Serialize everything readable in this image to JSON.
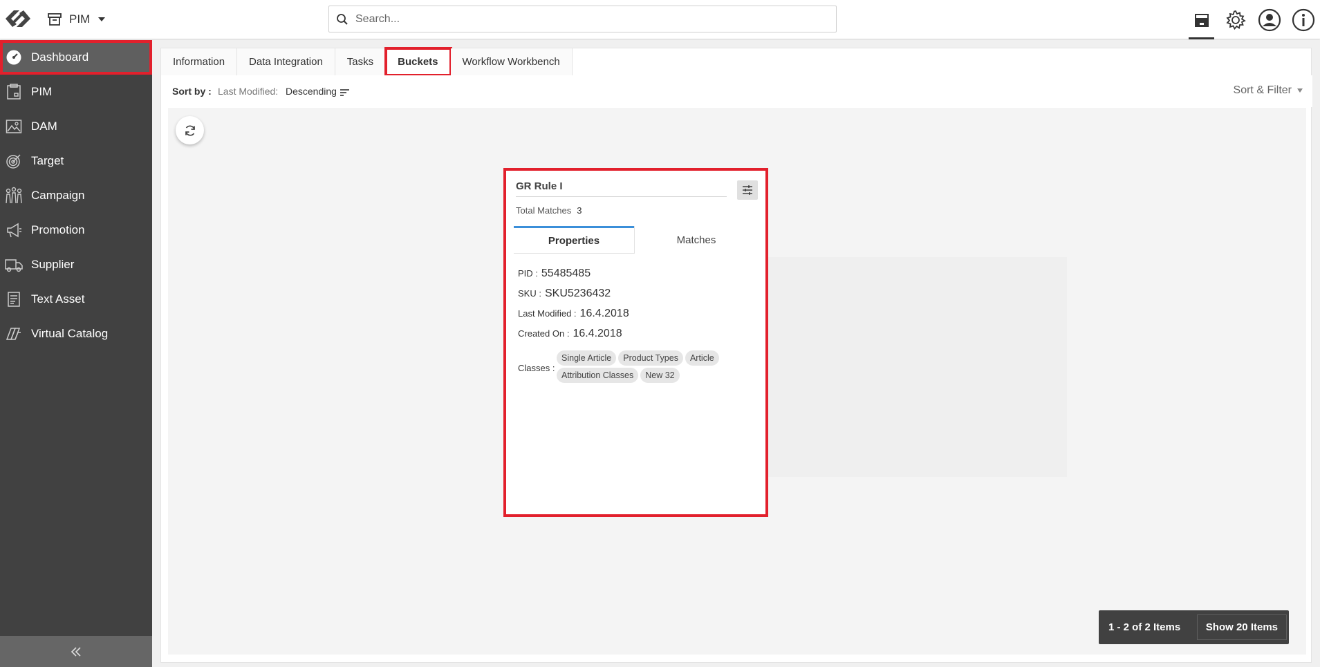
{
  "header": {
    "module": "PIM",
    "search_placeholder": "Search..."
  },
  "top_icons": [
    "catalog-box-icon",
    "gear-icon",
    "user-account-icon",
    "info-icon"
  ],
  "sidebar": {
    "items": [
      {
        "label": "Dashboard",
        "icon": "dashboard-icon"
      },
      {
        "label": "PIM",
        "icon": "pim-icon"
      },
      {
        "label": "DAM",
        "icon": "image-icon"
      },
      {
        "label": "Target",
        "icon": "target-icon"
      },
      {
        "label": "Campaign",
        "icon": "campaign-icon"
      },
      {
        "label": "Promotion",
        "icon": "megaphone-icon"
      },
      {
        "label": "Supplier",
        "icon": "truck-icon"
      },
      {
        "label": "Text Asset",
        "icon": "text-document-icon"
      },
      {
        "label": "Virtual Catalog",
        "icon": "catalog-pages-icon"
      }
    ],
    "collapse_icon": "double-chevron-left-icon"
  },
  "tabs": [
    {
      "label": "Information"
    },
    {
      "label": "Data Integration"
    },
    {
      "label": "Tasks"
    },
    {
      "label": "Buckets",
      "active": true
    },
    {
      "label": "Workflow Workbench"
    }
  ],
  "sort": {
    "label": "Sort by :",
    "field": "Last Modified:",
    "direction": "Descending",
    "filter_label": "Sort & Filter"
  },
  "card": {
    "title": "GR Rule I",
    "total_matches_label": "Total Matches",
    "total_matches": "3",
    "tabs": [
      "Properties",
      "Matches"
    ],
    "properties": [
      {
        "key": "PID :",
        "value": "55485485"
      },
      {
        "key": "SKU :",
        "value": "SKU5236432"
      },
      {
        "key": "Last Modified :",
        "value": "16.4.2018"
      },
      {
        "key": "Created On :",
        "value": "16.4.2018"
      }
    ],
    "classes_label": "Classes :",
    "classes": [
      "Single Article",
      "Product Types",
      "Article",
      "Attribution Classes",
      "New 32"
    ]
  },
  "pager": {
    "count": "1 - 2 of 2 Items",
    "show": "Show 20 Items"
  },
  "colors": {
    "highlight": "#e2202c",
    "sidebar_bg": "#414141",
    "active_tab_line": "#3b8fd9"
  }
}
